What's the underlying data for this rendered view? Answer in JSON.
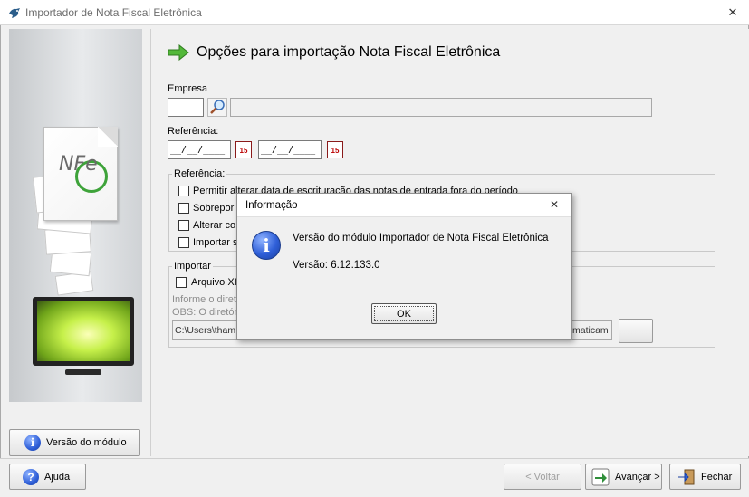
{
  "window": {
    "title": "Importador de Nota Fiscal Eletrônica",
    "close_glyph": "✕"
  },
  "header": {
    "title": "Opções para importação Nota Fiscal Eletrônica"
  },
  "empresa": {
    "label": "Empresa",
    "code_value": "",
    "name_value": ""
  },
  "referencia": {
    "label": "Referência:",
    "date_from": "__/__/____",
    "date_to": "__/__/____",
    "calendar_glyph": "15"
  },
  "referencia_group": {
    "title": "Referência:",
    "options": [
      {
        "label": "Permitir alterar data de escrituração das notas de entrada fora do período",
        "checked": false
      },
      {
        "label": "Sobrepor",
        "checked": false
      },
      {
        "label": "Alterar co",
        "checked": false
      },
      {
        "label": "Importar s",
        "checked": false
      }
    ]
  },
  "importar_group": {
    "title": "Importar",
    "option_label": "Arquivo XI",
    "note1": "Informe o diretó",
    "note2": "OBS: O diretór",
    "path_start": "C:\\Users\\tham",
    "path_end": "maticam",
    "browse_label": ""
  },
  "left_panel": {
    "logo_text": "NFe",
    "versao_button": "Versão do módulo"
  },
  "bottom": {
    "help_button": "Ajuda",
    "back_button": "< Voltar",
    "next_button": "Avançar >",
    "close_button": "Fechar"
  },
  "dialog": {
    "title": "Informação",
    "close_glyph": "✕",
    "icon_glyph": "i",
    "message": "Versão do módulo Importador de Nota Fiscal Eletrônica",
    "version": "Versão: 6.12.133.0",
    "ok_label": "OK"
  },
  "colors": {
    "accent_green": "#3ea33a",
    "info_blue": "#2f5fd8",
    "window_bg": "#f0f0f0"
  }
}
